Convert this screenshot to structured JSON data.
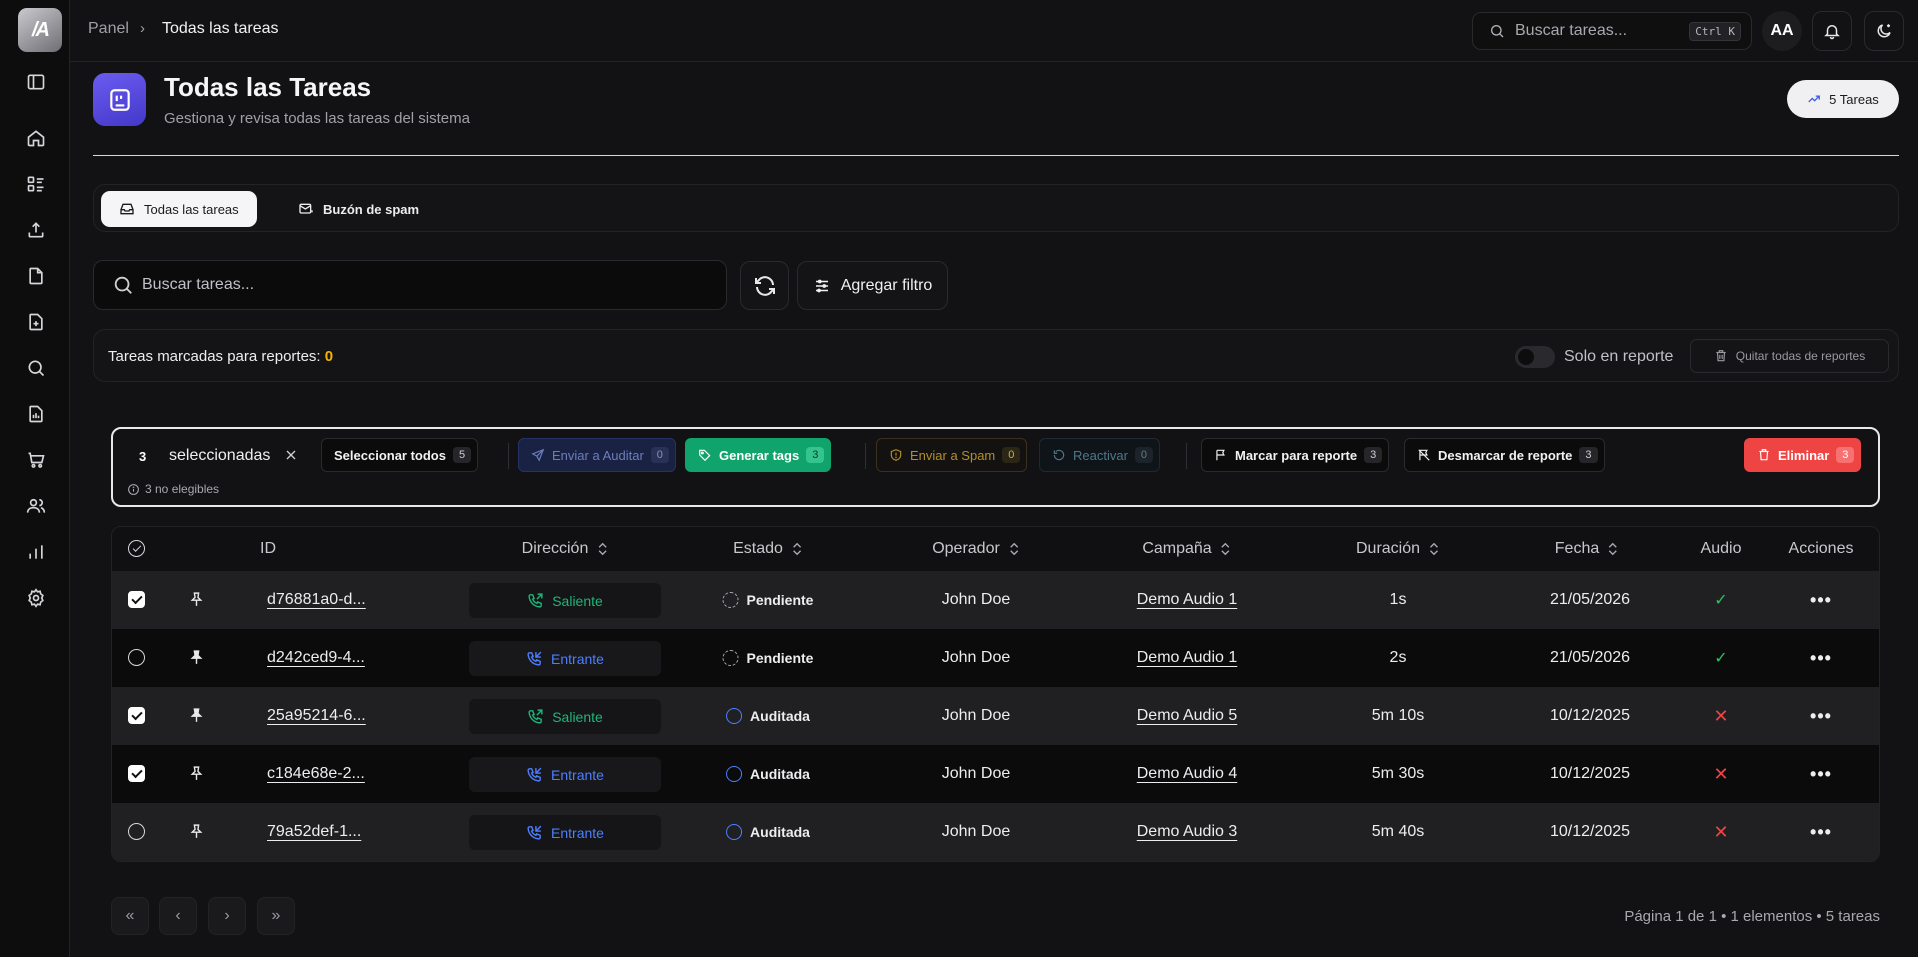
{
  "app": {
    "logo_text": "/A"
  },
  "breadcrumb": {
    "root": "Panel",
    "separator": "›",
    "current": "Todas las tareas"
  },
  "topbar": {
    "search_placeholder": "Buscar tareas...",
    "shortcut": "Ctrl K",
    "avatar_initials": "AA"
  },
  "header": {
    "title": "Todas las Tareas",
    "subtitle": "Gestiona y revisa todas las tareas del sistema",
    "count_label": "5 Tareas"
  },
  "tabs": [
    {
      "label": "Todas las tareas"
    },
    {
      "label": "Buzón de spam"
    }
  ],
  "search": {
    "placeholder": "Buscar tareas...",
    "filter_label": "Agregar filtro"
  },
  "report_bar": {
    "label": "Tareas marcadas para reportes:",
    "count": "0",
    "toggle_label": "Solo en reporte",
    "clear_label": "Quitar todas de reportes"
  },
  "bulk": {
    "selected_count": "3",
    "selected_label": "seleccionadas",
    "ineligible": "3 no elegibles",
    "select_all": {
      "label": "Seleccionar todos",
      "badge": "5"
    },
    "send_audit": {
      "label": "Enviar a Auditar",
      "badge": "0"
    },
    "generate_tags": {
      "label": "Generar tags",
      "badge": "3"
    },
    "send_spam": {
      "label": "Enviar a Spam",
      "badge": "0"
    },
    "reactivate": {
      "label": "Reactivar",
      "badge": "0"
    },
    "mark_report": {
      "label": "Marcar para reporte",
      "badge": "3"
    },
    "unmark_report": {
      "label": "Desmarcar de reporte",
      "badge": "3"
    },
    "delete": {
      "label": "Eliminar",
      "badge": "3"
    }
  },
  "table": {
    "headers": {
      "id": "ID",
      "direction": "Dirección",
      "status": "Estado",
      "operator": "Operador",
      "campaign": "Campaña",
      "duration": "Duración",
      "date": "Fecha",
      "audio": "Audio",
      "actions": "Acciones"
    },
    "rows": [
      {
        "checked": true,
        "pinned": false,
        "id": "d76881a0-d...",
        "direction": "Saliente",
        "status": "Pendiente",
        "operator": "John Doe",
        "campaign": "Demo Audio 1",
        "duration": "1s",
        "date": "21/05/2026",
        "audio": "✓"
      },
      {
        "checked": false,
        "pinned": true,
        "id": "d242ced9-4...",
        "direction": "Entrante",
        "status": "Pendiente",
        "operator": "John Doe",
        "campaign": "Demo Audio 1",
        "duration": "2s",
        "date": "21/05/2026",
        "audio": "✓"
      },
      {
        "checked": true,
        "pinned": true,
        "id": "25a95214-6...",
        "direction": "Saliente",
        "status": "Auditada",
        "operator": "John Doe",
        "campaign": "Demo Audio 5",
        "duration": "5m 10s",
        "date": "10/12/2025",
        "audio": "✕"
      },
      {
        "checked": true,
        "pinned": false,
        "id": "c184e68e-2...",
        "direction": "Entrante",
        "status": "Auditada",
        "operator": "John Doe",
        "campaign": "Demo Audio 4",
        "duration": "5m 30s",
        "date": "10/12/2025",
        "audio": "✕"
      },
      {
        "checked": false,
        "pinned": false,
        "id": "79a52def-1...",
        "direction": "Entrante",
        "status": "Auditada",
        "operator": "John Doe",
        "campaign": "Demo Audio 3",
        "duration": "5m 40s",
        "date": "10/12/2025",
        "audio": "✕"
      }
    ],
    "row_action": "•••"
  },
  "pagination": {
    "first": "«",
    "prev": "‹",
    "next": "›",
    "last": "»",
    "info": "Página 1 de 1 • 1 elementos • 5 tareas"
  },
  "colors": {
    "accent_purple": "#5b4ee6",
    "success": "#10a36b",
    "danger": "#ef4444",
    "warning": "#f5b400",
    "info_blue": "#4d7fff"
  }
}
